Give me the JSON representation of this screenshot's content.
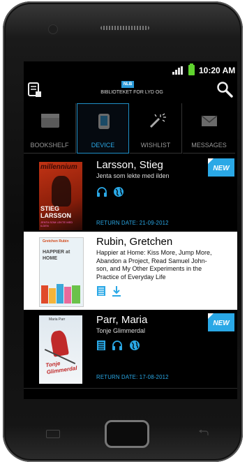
{
  "status": {
    "time": "10:20 AM"
  },
  "header": {
    "logo_text": "NLB",
    "app_title": "BIBLIOTEKET FOR LYD OG"
  },
  "tabs": [
    {
      "label": "BOOKSHELF"
    },
    {
      "label": "DEVICE"
    },
    {
      "label": "WISHLIST"
    },
    {
      "label": "MESSAGES"
    }
  ],
  "books": [
    {
      "author": "Larsson, Stieg",
      "title": "Jenta som lekte med ilden",
      "badge": "NEW",
      "return_date": "RETURN DATE: 21-09-2012",
      "cover": {
        "top_text": "millennium",
        "author": "STIEG LARSSON",
        "title": "JENTA SOM LEKTE MED ILDEN"
      },
      "icons": [
        "headphones-icon",
        "globe-icon"
      ]
    },
    {
      "author": "Rubin, Gretchen",
      "title": "Happier at Home: Kiss More, Jump More, Abandon a Project, Read Samuel Johnson, and My Other Experiments in the Practice of Everyday Life",
      "title_lines": [
        "Happier at Home: Kiss More, Jump More,",
        "Abandon a Project, Read Samuel John-",
        "son, and My Other Experiments in the",
        "Practice of Everyday Life"
      ],
      "cover": {
        "top_text": "Gretchen Rubin",
        "title": "HAPPIER at HOME"
      },
      "icons": [
        "document-icon",
        "download-icon"
      ]
    },
    {
      "author": "Parr, Maria",
      "title": "Tonje Glimmerdal",
      "badge": "NEW",
      "return_date": "RETURN DATE: 17-08-2012",
      "cover": {
        "top_text": "Maria Parr",
        "title": "Tonje Glimmerdal"
      },
      "icons": [
        "document-icon",
        "headphones-icon",
        "globe-icon"
      ]
    }
  ]
}
